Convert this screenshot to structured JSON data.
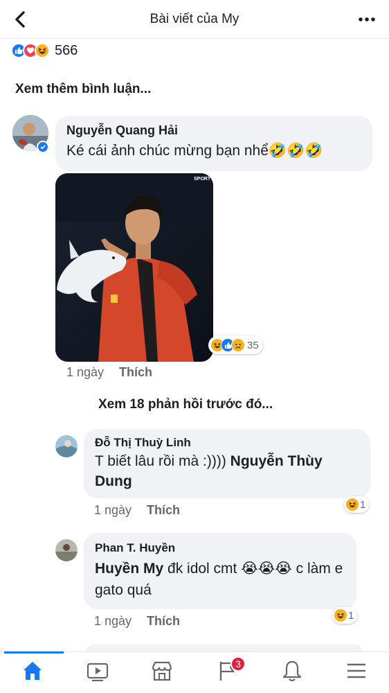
{
  "header": {
    "title": "Bài viết của My",
    "back_icon": "chevron-left-icon",
    "more_icon": "more-horizontal-icon"
  },
  "post_reactions": {
    "icons": [
      "like",
      "love",
      "haha"
    ],
    "count": "566"
  },
  "view_more_comments": "Xem thêm bình luận...",
  "comment_main": {
    "author": "Nguyễn Quang Hải",
    "text": "Ké cái ảnh chúc mừng bạn nhể🤣🤣🤣",
    "verified": true,
    "photo_watermark": "SPORT",
    "reactions": {
      "icons": [
        "haha",
        "like",
        "sad"
      ],
      "count": "35"
    },
    "time": "1 ngày",
    "like_label": "Thích"
  },
  "view_previous_replies": "Xem 18 phản hồi trước đó...",
  "replies": [
    {
      "author": "Đỗ Thị Thuỳ Linh",
      "text_before": "T biết lâu rồi mà :)))) ",
      "mention": "Nguyễn Thùy Dung",
      "text_after": "",
      "reactions": {
        "icons": [
          "haha"
        ],
        "count": "1"
      },
      "time": "1 ngày",
      "like_label": "Thích"
    },
    {
      "author": "Phan T. Huyền",
      "mention": "Huyền My",
      "text_after": "  đk idol cmt 😭😭😭 c làm e gato quá",
      "reactions": {
        "icons": [
          "haha"
        ],
        "count": "1"
      },
      "time": "1 ngày",
      "like_label": "Thích"
    }
  ],
  "bottom_nav": {
    "items": [
      "home-icon",
      "watch-icon",
      "marketplace-icon",
      "pages-icon",
      "notifications-icon",
      "menu-icon"
    ],
    "pages_badge": "3",
    "active": "home-icon"
  },
  "colors": {
    "accent": "#1877f2",
    "bubble": "#f0f2f5",
    "badge": "#e41e3f",
    "meta": "#65676b"
  }
}
